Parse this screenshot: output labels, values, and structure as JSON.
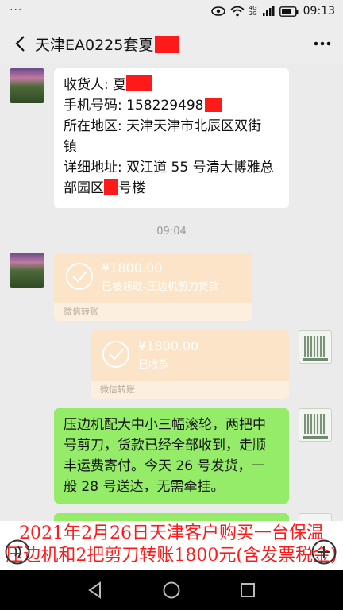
{
  "status_bar": {
    "menu_dots": "···",
    "network": "4G",
    "network2": "2G",
    "time": "09:13"
  },
  "header": {
    "title": "天津EA0225套夏"
  },
  "messages": {
    "address": {
      "line1": "收货人: 夏",
      "line2": "手机号码: 158229498",
      "line3": "所在地区: 天津天津市北辰区双街",
      "line4": "镇",
      "line5": "详细地址: 双江道 55 号清大博雅总",
      "line6a": "部园区",
      "line6b": "号楼"
    },
    "timestamp": "09:04",
    "transfer_received": {
      "amount": "¥1800.00",
      "note": "已被领取-压边机剪刀货款",
      "source": "微信转账"
    },
    "transfer_sent": {
      "amount": "¥1800.00",
      "note": "已收款",
      "source": "微信转账"
    },
    "reply": {
      "line1": "压边机配大中小三幅滚轮，两把中",
      "line2": "号剪刀，货款已经全部收到，走顺",
      "line3": "丰运费寄付。今天 26 号发货，一",
      "line4": "般 28 号送达，无需牵挂。"
    }
  },
  "caption": {
    "line1": "2021年2月26日天津客户购买一台保温",
    "line2": "压边机和2把剪刀转账1800元(含发票税金)"
  },
  "icons": {
    "back": "chevron-left-icon",
    "more": "more-icon",
    "voice": "voice-icon",
    "plus": "plus-icon",
    "nav_back": "triangle-back-icon",
    "nav_home": "circle-home-icon",
    "nav_recent": "square-recent-icon"
  },
  "colors": {
    "green_bubble": "#95ec69",
    "redaction": "#ff1a1a",
    "transfer": "#fbe4c8",
    "caption_text": "#ff1a1a"
  }
}
